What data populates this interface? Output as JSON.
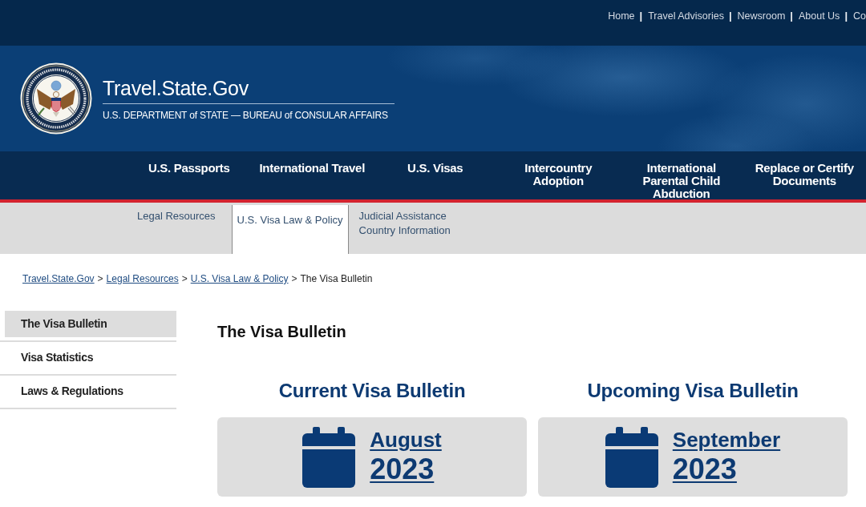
{
  "utility_nav": [
    {
      "label": "Home",
      "separator": "|"
    },
    {
      "label": "Travel Advisories",
      "separator": "|"
    },
    {
      "label": "Newsroom",
      "separator": "|"
    },
    {
      "label": "About Us",
      "separator": "|"
    },
    {
      "label": "Co"
    }
  ],
  "header": {
    "title": "Travel.State.Gov",
    "subtitle": "U.S. DEPARTMENT of STATE — BUREAU of CONSULAR AFFAIRS"
  },
  "main_nav": [
    "U.S. Passports",
    "International Travel",
    "U.S. Visas",
    "Intercountry Adoption",
    "International Parental Child Abduction",
    "Replace or Certify Documents"
  ],
  "sub_nav": [
    {
      "label": "Legal Resources",
      "selected": false
    },
    {
      "label": "U.S. Visa Law & Policy",
      "selected": true
    },
    {
      "label": "Judicial Assistance Country Information",
      "selected": false
    }
  ],
  "breadcrumb": [
    {
      "label": "Travel.State.Gov",
      "kind": "link",
      "separator": ">"
    },
    {
      "label": "Legal Resources",
      "kind": "link",
      "separator": ">"
    },
    {
      "label": "U.S. Visa Law & Policy",
      "kind": "link",
      "separator": ">"
    },
    {
      "label": "The Visa Bulletin",
      "kind": "current"
    }
  ],
  "sidebar": {
    "items": [
      {
        "label": "The Visa Bulletin",
        "selected": true
      },
      {
        "label": "Visa Statistics",
        "selected": false
      },
      {
        "label": "Laws & Regulations",
        "selected": false
      }
    ]
  },
  "page_title": "The Visa Bulletin",
  "bulletins": [
    {
      "heading": "Current Visa Bulletin",
      "month": "August",
      "year": "2023"
    },
    {
      "heading": "Upcoming Visa Bulletin",
      "month": "September",
      "year": "2023"
    }
  ]
}
